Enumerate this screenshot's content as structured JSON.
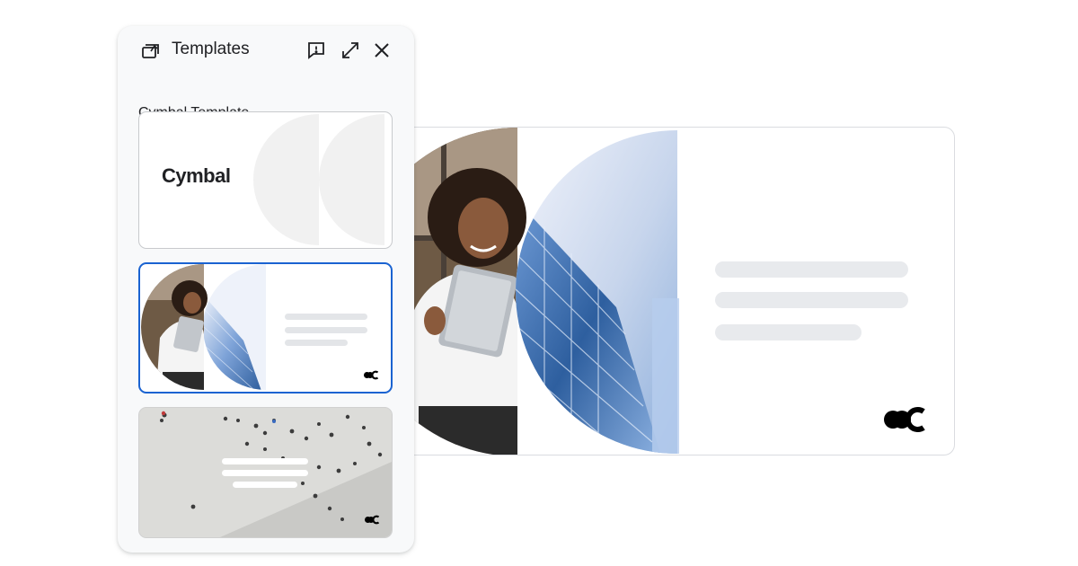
{
  "panel": {
    "title": "Templates",
    "subtitle": "Cymbal Template",
    "icons": {
      "templates": "templates-icon",
      "feedback": "feedback-icon",
      "expand": "expand-icon",
      "close": "close-icon"
    }
  },
  "templates": [
    {
      "brand_name": "Cymbal",
      "selected": false
    },
    {
      "selected": true
    },
    {
      "selected": false
    }
  ],
  "colors": {
    "selection": "#1a63d1",
    "text_placeholder": "#e8eaed",
    "panel_bg": "#f8f9fa"
  }
}
